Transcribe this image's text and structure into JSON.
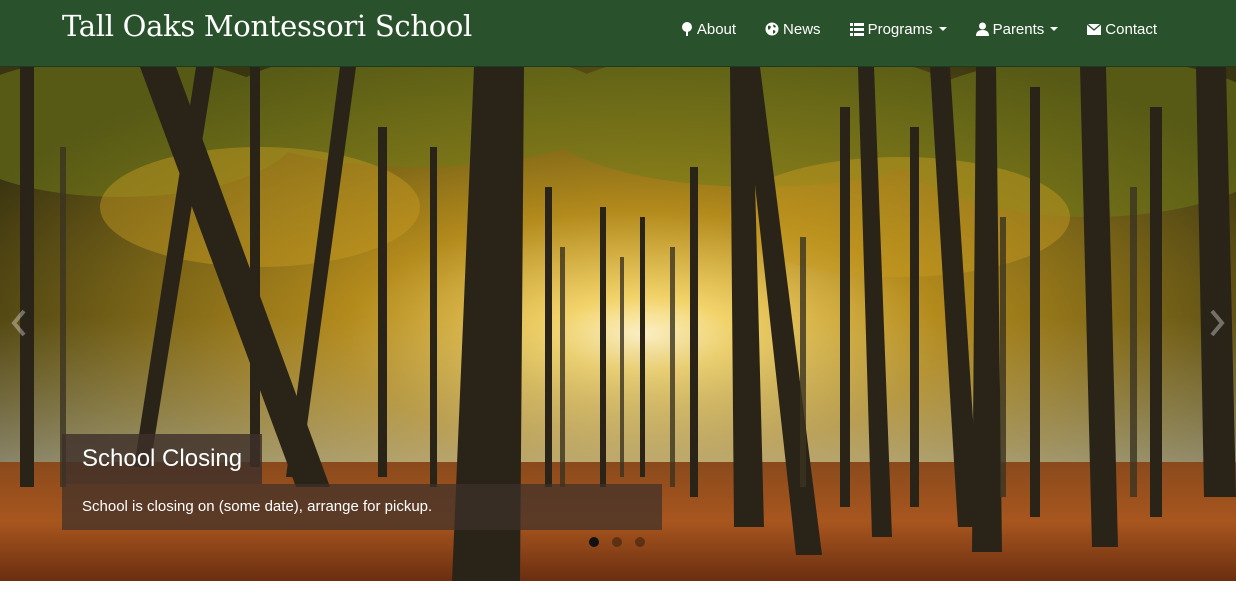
{
  "brand": {
    "title": "Tall Oaks Montessori School"
  },
  "nav": {
    "items": [
      {
        "label": "About",
        "icon": "tree-icon"
      },
      {
        "label": "News",
        "icon": "globe-icon"
      },
      {
        "label": "Programs",
        "icon": "list-icon",
        "dropdown": true
      },
      {
        "label": "Parents",
        "icon": "user-icon",
        "dropdown": true
      },
      {
        "label": "Contact",
        "icon": "envelope-icon"
      }
    ]
  },
  "carousel": {
    "slide": {
      "title": "School Closing",
      "text": "School is closing on (some date), arrange for pickup."
    },
    "indicators": {
      "count": 3,
      "active": 1
    }
  },
  "colors": {
    "navbar": "#29522c",
    "caption_bg": "#3e302a",
    "text": "#ffffff"
  }
}
